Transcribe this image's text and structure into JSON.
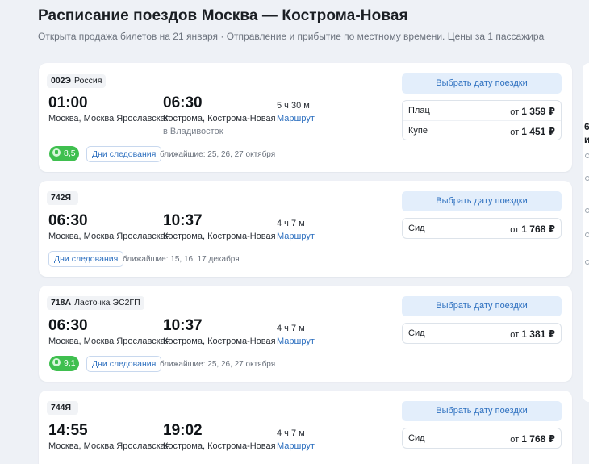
{
  "header": {
    "title": "Расписание поездов Москва — Кострома-Новая",
    "subtitle": "Открыта продажа билетов на 21 января · Отправление и прибытие по местному времени. Цены за 1 пассажира"
  },
  "common": {
    "date_button": "Выбрать дату поездки",
    "route_link": "Маршрут",
    "days_button": "Дни следования"
  },
  "trains": [
    {
      "number": "002Э",
      "name": "Россия",
      "depart_time": "01:00",
      "depart_station": "Москва, Москва Ярославская",
      "arrive_time": "06:30",
      "arrive_station": "Кострома, Кострома-Новая",
      "arrive_note": "в Владивосток",
      "duration": "5 ч 30 м",
      "rating": "8,5",
      "nearest": "ближайшие: 25, 26, 27 октября",
      "prices": [
        {
          "class": "Плац",
          "prefix": "от",
          "amount": "1 359 ₽"
        },
        {
          "class": "Купе",
          "prefix": "от",
          "amount": "1 451 ₽"
        }
      ]
    },
    {
      "number": "742Я",
      "name": "",
      "depart_time": "06:30",
      "depart_station": "Москва, Москва Ярославская",
      "arrive_time": "10:37",
      "arrive_station": "Кострома, Кострома-Новая",
      "duration": "4 ч 7 м",
      "nearest": "ближайшие: 15, 16, 17 декабря",
      "prices": [
        {
          "class": "Сид",
          "prefix": "от",
          "amount": "1 768 ₽"
        }
      ]
    },
    {
      "number": "718А",
      "name": "Ласточка ЭС2ГП",
      "depart_time": "06:30",
      "depart_station": "Москва, Москва Ярославская",
      "arrive_time": "10:37",
      "arrive_station": "Кострома, Кострома-Новая",
      "duration": "4 ч 7 м",
      "rating": "9,1",
      "nearest": "ближайшие: 25, 26, 27 октября",
      "prices": [
        {
          "class": "Сид",
          "prefix": "от",
          "amount": "1 381 ₽"
        }
      ]
    },
    {
      "number": "744Я",
      "name": "",
      "depart_time": "14:55",
      "depart_station": "Москва, Москва Ярославская",
      "arrive_time": "19:02",
      "arrive_station": "Кострома, Кострома-Новая",
      "duration": "4 ч 7 м",
      "prices": [
        {
          "class": "Сид",
          "prefix": "от",
          "amount": "1 768 ₽"
        }
      ]
    }
  ],
  "right_panel": {
    "text_1": "6",
    "text_2": "и"
  }
}
